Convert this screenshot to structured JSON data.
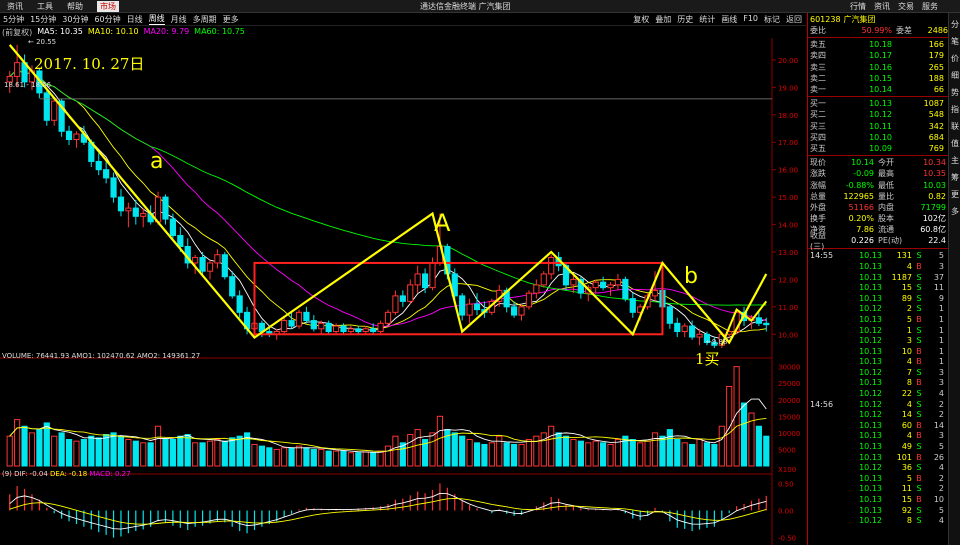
{
  "menu": {
    "items": [
      "资讯",
      "工具",
      "帮助",
      "市场"
    ],
    "active": "市场",
    "window_title": "通达信金融终端 广汽集团",
    "right_items": [
      "行情",
      "资讯",
      "交易",
      "服务"
    ]
  },
  "toolbar": {
    "periods": [
      "5分钟",
      "15分钟",
      "30分钟",
      "60分钟",
      "日线",
      "周线",
      "月线",
      "多周期",
      "更多"
    ],
    "selected": "周线",
    "right_tools": [
      "复权",
      "叠加",
      "历史",
      "统计",
      "画线",
      "F10",
      "标记",
      "返回"
    ]
  },
  "legend": {
    "label": "(前复权)",
    "ma5": "MA5: 10.35",
    "ma10": "MA10: 10.10",
    "ma20": "MA20: 9.79",
    "ma60": "MA60: 10.75"
  },
  "annotations": {
    "date": "2017. 10. 27日",
    "a": "a",
    "A": "A",
    "b": "b",
    "buy": "1买",
    "high_price": "20.55",
    "low_price": "9.88",
    "h_line": "18.61 - 18.56"
  },
  "sub_legends": {
    "vol": "VOLUME: 76441.93  AMO1: 102470.62  AMO2: 149361.27",
    "macd_dif": "(9) DIF: -0.04",
    "macd_dea": "DEA: -0.18",
    "macd_macd": "MACD: 0.27"
  },
  "colors": {
    "up": "#ff3333",
    "down": "#00e5ee",
    "ma5": "#ffffff",
    "ma10": "#ffff00",
    "ma20": "#ff00ff",
    "ma60": "#00ff00",
    "yellow_drawing": "#ffff00",
    "box": "#ff2020"
  },
  "chart_data": {
    "type": "candlestick",
    "y_ticks": [
      "20.00",
      "19.00",
      "18.00",
      "17.00",
      "16.00",
      "15.00",
      "14.00",
      "13.00",
      "12.00",
      "11.00",
      "10.00"
    ],
    "vol_ticks": [
      "30000",
      "25000",
      "20000",
      "15000",
      "10000",
      "5000"
    ],
    "vol_unit": "X100",
    "macd_ticks": [
      "0.50",
      "0.00",
      "-0.50"
    ],
    "ylim": [
      9.5,
      20.8
    ],
    "candles": [
      [
        19.2,
        19.6,
        18.8,
        19.4
      ],
      [
        19.4,
        20.55,
        19.0,
        19.9
      ],
      [
        19.9,
        20.2,
        19.0,
        19.2
      ],
      [
        19.2,
        19.8,
        18.9,
        19.6
      ],
      [
        19.6,
        19.7,
        18.6,
        18.8
      ],
      [
        18.8,
        19.0,
        17.6,
        17.8
      ],
      [
        17.8,
        18.6,
        17.6,
        18.5
      ],
      [
        18.5,
        18.6,
        17.2,
        17.4
      ],
      [
        17.4,
        17.6,
        16.9,
        17.1
      ],
      [
        17.1,
        17.4,
        16.8,
        17.3
      ],
      [
        17.3,
        17.6,
        16.9,
        17.0
      ],
      [
        17.0,
        17.1,
        16.1,
        16.3
      ],
      [
        16.3,
        16.6,
        15.8,
        16.0
      ],
      [
        16.0,
        16.4,
        15.5,
        15.7
      ],
      [
        15.7,
        15.9,
        14.8,
        15.0
      ],
      [
        15.0,
        15.3,
        14.3,
        14.5
      ],
      [
        14.5,
        14.8,
        13.9,
        14.6
      ],
      [
        14.6,
        14.9,
        14.0,
        14.3
      ],
      [
        14.3,
        14.6,
        13.9,
        14.4
      ],
      [
        14.4,
        14.7,
        14.0,
        14.1
      ],
      [
        14.1,
        15.2,
        14.0,
        15.0
      ],
      [
        15.0,
        15.1,
        14.0,
        14.2
      ],
      [
        14.2,
        14.4,
        13.5,
        13.6
      ],
      [
        13.6,
        13.9,
        13.0,
        13.2
      ],
      [
        13.2,
        13.5,
        12.4,
        12.6
      ],
      [
        12.6,
        12.9,
        12.2,
        12.8
      ],
      [
        12.8,
        13.0,
        12.2,
        12.3
      ],
      [
        12.3,
        12.7,
        12.0,
        12.6
      ],
      [
        12.6,
        13.1,
        12.4,
        12.9
      ],
      [
        12.9,
        13.0,
        12.0,
        12.1
      ],
      [
        12.1,
        12.3,
        11.3,
        11.4
      ],
      [
        11.4,
        11.6,
        10.6,
        10.8
      ],
      [
        10.8,
        11.0,
        10.0,
        10.2
      ],
      [
        10.2,
        10.6,
        9.9,
        10.4
      ],
      [
        10.4,
        10.5,
        9.9,
        10.1
      ],
      [
        10.1,
        10.3,
        9.9,
        10.0
      ],
      [
        10.0,
        10.2,
        9.8,
        10.1
      ],
      [
        10.1,
        10.6,
        10.0,
        10.5
      ],
      [
        10.5,
        10.8,
        10.2,
        10.3
      ],
      [
        10.3,
        10.9,
        10.2,
        10.8
      ],
      [
        10.8,
        11.0,
        10.4,
        10.5
      ],
      [
        10.5,
        10.7,
        10.1,
        10.2
      ],
      [
        10.2,
        10.5,
        10.0,
        10.4
      ],
      [
        10.4,
        10.5,
        10.0,
        10.1
      ],
      [
        10.1,
        10.4,
        10.0,
        10.3
      ],
      [
        10.3,
        10.4,
        10.0,
        10.1
      ],
      [
        10.1,
        10.3,
        10.0,
        10.2
      ],
      [
        10.2,
        10.3,
        10.0,
        10.1
      ],
      [
        10.1,
        10.3,
        10.0,
        10.2
      ],
      [
        10.2,
        10.4,
        10.0,
        10.1
      ],
      [
        10.1,
        10.5,
        10.0,
        10.4
      ],
      [
        10.4,
        10.9,
        10.3,
        10.8
      ],
      [
        10.8,
        11.6,
        10.7,
        11.4
      ],
      [
        11.4,
        11.6,
        11.0,
        11.2
      ],
      [
        11.2,
        12.0,
        11.1,
        11.8
      ],
      [
        11.8,
        12.5,
        11.5,
        12.2
      ],
      [
        12.2,
        12.4,
        11.5,
        11.7
      ],
      [
        11.7,
        12.8,
        11.6,
        12.6
      ],
      [
        12.6,
        14.4,
        12.5,
        13.2
      ],
      [
        13.2,
        13.3,
        12.0,
        12.2
      ],
      [
        12.2,
        12.4,
        11.2,
        11.4
      ],
      [
        11.4,
        11.5,
        10.5,
        10.7
      ],
      [
        10.7,
        11.3,
        10.4,
        11.1
      ],
      [
        11.1,
        11.5,
        10.7,
        10.9
      ],
      [
        10.9,
        11.2,
        10.6,
        10.8
      ],
      [
        10.8,
        11.3,
        10.7,
        11.2
      ],
      [
        11.2,
        11.8,
        11.0,
        11.6
      ],
      [
        11.6,
        11.7,
        10.8,
        11.0
      ],
      [
        11.0,
        11.2,
        10.6,
        10.7
      ],
      [
        10.7,
        11.1,
        10.5,
        11.0
      ],
      [
        11.0,
        11.6,
        10.9,
        11.5
      ],
      [
        11.5,
        12.0,
        11.3,
        11.8
      ],
      [
        11.8,
        12.3,
        11.7,
        12.2
      ],
      [
        12.2,
        12.9,
        12.0,
        12.8
      ],
      [
        12.8,
        13.0,
        12.3,
        12.5
      ],
      [
        12.5,
        12.6,
        11.6,
        11.8
      ],
      [
        11.8,
        12.2,
        11.5,
        12.0
      ],
      [
        12.0,
        12.1,
        11.3,
        11.5
      ],
      [
        11.5,
        11.8,
        11.2,
        11.7
      ],
      [
        11.7,
        12.0,
        11.5,
        11.9
      ],
      [
        11.9,
        12.1,
        11.6,
        11.7
      ],
      [
        11.7,
        11.9,
        11.4,
        11.8
      ],
      [
        11.8,
        12.2,
        11.6,
        12.0
      ],
      [
        12.0,
        12.1,
        11.2,
        11.3
      ],
      [
        11.3,
        11.5,
        10.6,
        10.8
      ],
      [
        10.8,
        11.1,
        10.5,
        11.0
      ],
      [
        11.0,
        11.5,
        10.9,
        11.4
      ],
      [
        11.4,
        12.3,
        11.2,
        11.6
      ],
      [
        11.6,
        11.8,
        10.9,
        11.0
      ],
      [
        11.0,
        11.1,
        10.2,
        10.4
      ],
      [
        10.4,
        10.6,
        9.9,
        10.1
      ],
      [
        10.1,
        10.4,
        9.9,
        10.3
      ],
      [
        10.3,
        10.5,
        9.8,
        9.9
      ],
      [
        9.9,
        10.2,
        9.6,
        10.0
      ],
      [
        10.0,
        10.1,
        9.6,
        9.7
      ],
      [
        9.7,
        9.9,
        9.5,
        9.6
      ],
      [
        9.6,
        10.1,
        9.5,
        10.0
      ],
      [
        10.0,
        10.2,
        9.88,
        10.1
      ],
      [
        10.1,
        10.9,
        10.0,
        10.8
      ],
      [
        10.8,
        11.0,
        10.3,
        10.5
      ],
      [
        10.5,
        10.7,
        10.2,
        10.6
      ],
      [
        10.6,
        10.8,
        10.3,
        10.4
      ],
      [
        10.4,
        10.6,
        10.1,
        10.35
      ]
    ],
    "volumes": [
      9000,
      14000,
      12000,
      10000,
      11000,
      13000,
      9000,
      10000,
      8000,
      7500,
      8000,
      9000,
      8500,
      9500,
      10000,
      9000,
      8000,
      7500,
      7000,
      7000,
      12000,
      8000,
      8000,
      9000,
      9500,
      7000,
      7000,
      7500,
      8000,
      7500,
      8500,
      9000,
      10000,
      6500,
      6000,
      5500,
      5000,
      5500,
      5500,
      6000,
      5500,
      5000,
      5000,
      4500,
      4500,
      4500,
      4000,
      4000,
      4200,
      4000,
      4500,
      6000,
      9000,
      7000,
      9500,
      11000,
      8000,
      10000,
      15000,
      11000,
      10000,
      9000,
      8000,
      7000,
      6500,
      7000,
      9000,
      7000,
      6500,
      6500,
      8000,
      9000,
      10000,
      12000,
      10000,
      9000,
      8000,
      7500,
      7000,
      7500,
      7000,
      6500,
      8000,
      9000,
      8000,
      7000,
      7500,
      10000,
      9000,
      11000,
      8000,
      7000,
      6500,
      8000,
      7000,
      6500,
      12000,
      24000,
      30000,
      19000,
      16000,
      12000,
      9000
    ],
    "macd": [
      0.3,
      0.45,
      0.4,
      0.3,
      0.2,
      0.05,
      -0.05,
      -0.15,
      -0.2,
      -0.25,
      -0.3,
      -0.35,
      -0.4,
      -0.45,
      -0.5,
      -0.48,
      -0.42,
      -0.38,
      -0.35,
      -0.3,
      -0.2,
      -0.22,
      -0.28,
      -0.32,
      -0.36,
      -0.3,
      -0.28,
      -0.24,
      -0.2,
      -0.22,
      -0.3,
      -0.38,
      -0.42,
      -0.36,
      -0.3,
      -0.25,
      -0.2,
      -0.12,
      -0.06,
      0.02,
      0.05,
      0.04,
      0.03,
      0.02,
      0.03,
      0.02,
      0.03,
      0.04,
      0.05,
      0.06,
      0.08,
      0.12,
      0.2,
      0.22,
      0.28,
      0.35,
      0.32,
      0.38,
      0.5,
      0.42,
      0.3,
      0.18,
      0.1,
      0.04,
      0.0,
      -0.05,
      0.02,
      -0.06,
      -0.1,
      -0.08,
      0.02,
      0.08,
      0.15,
      0.25,
      0.22,
      0.12,
      0.1,
      0.04,
      0.02,
      0.03,
      0.02,
      0.01,
      0.04,
      -0.05,
      -0.15,
      -0.18,
      -0.1,
      0.05,
      -0.04,
      -0.2,
      -0.32,
      -0.34,
      -0.38,
      -0.35,
      -0.32,
      -0.3,
      -0.18,
      -0.05,
      0.08,
      0.12,
      0.18,
      0.22,
      0.27
    ]
  },
  "drawing": {
    "zigzag": [
      [
        0,
        20.55
      ],
      [
        33,
        9.88
      ],
      [
        57,
        14.4
      ],
      [
        61,
        10.1
      ],
      [
        73,
        13.0
      ],
      [
        84,
        10.0
      ],
      [
        88,
        12.6
      ],
      [
        97,
        9.7
      ],
      [
        102,
        12.2
      ]
    ],
    "zigzag2": [
      [
        96,
        9.6
      ],
      [
        98,
        10.9
      ],
      [
        100,
        10.5
      ],
      [
        102,
        11.2
      ]
    ],
    "box": {
      "x0": 33,
      "x1": 88,
      "y0": 10.0,
      "y1": 12.6
    }
  },
  "quote": {
    "code": "601238",
    "name": "广汽集团",
    "webi_label": "委比",
    "webi": "50.99%",
    "weicha_label": "委差",
    "weicha": "2486",
    "asks": [
      {
        "label": "卖五",
        "price": "10.18",
        "vol": "166"
      },
      {
        "label": "卖四",
        "price": "10.17",
        "vol": "179"
      },
      {
        "label": "卖三",
        "price": "10.16",
        "vol": "265"
      },
      {
        "label": "卖二",
        "price": "10.15",
        "vol": "188"
      },
      {
        "label": "卖一",
        "price": "10.14",
        "vol": "66"
      }
    ],
    "bids": [
      {
        "label": "买一",
        "price": "10.13",
        "vol": "1087"
      },
      {
        "label": "买二",
        "price": "10.12",
        "vol": "548"
      },
      {
        "label": "买三",
        "price": "10.11",
        "vol": "342"
      },
      {
        "label": "买四",
        "price": "10.10",
        "vol": "684"
      },
      {
        "label": "买五",
        "price": "10.09",
        "vol": "769"
      }
    ],
    "stats": [
      {
        "a": "现价",
        "av": "10.14",
        "ac": "green",
        "b": "今开",
        "bv": "10.34",
        "bc": "red"
      },
      {
        "a": "涨跌",
        "av": "-0.09",
        "ac": "green",
        "b": "最高",
        "bv": "10.35",
        "bc": "red"
      },
      {
        "a": "涨幅",
        "av": "-0.88%",
        "ac": "green",
        "b": "最低",
        "bv": "10.03",
        "bc": "green"
      },
      {
        "a": "总量",
        "av": "122965",
        "ac": "yellow",
        "b": "量比",
        "bv": "0.82",
        "bc": "yellow"
      },
      {
        "a": "外盘",
        "av": "51166",
        "ac": "red",
        "b": "内盘",
        "bv": "71799",
        "bc": "green"
      },
      {
        "a": "换手",
        "av": "0.20%",
        "ac": "yellow",
        "b": "股本",
        "bv": "102亿",
        "bc": "white"
      },
      {
        "a": "净资",
        "av": "7.86",
        "ac": "yellow",
        "b": "流通",
        "bv": "60.8亿",
        "bc": "white"
      },
      {
        "a": "收益(三)",
        "av": "0.226",
        "ac": "white",
        "b": "PE(动)",
        "bv": "22.4",
        "bc": "white"
      }
    ],
    "ticks": [
      {
        "t": "14:55",
        "p": "10.13",
        "v": "131",
        "d": "S",
        "n": "5"
      },
      {
        "t": "",
        "p": "10.13",
        "v": "4",
        "d": "B",
        "n": "3"
      },
      {
        "t": "",
        "p": "10.13",
        "v": "1187",
        "d": "S",
        "n": "37"
      },
      {
        "t": "",
        "p": "10.13",
        "v": "15",
        "d": "S",
        "n": "11"
      },
      {
        "t": "",
        "p": "10.13",
        "v": "89",
        "d": "S",
        "n": "9"
      },
      {
        "t": "",
        "p": "10.12",
        "v": "2",
        "d": "S",
        "n": "1"
      },
      {
        "t": "",
        "p": "10.13",
        "v": "5",
        "d": "B",
        "n": "1"
      },
      {
        "t": "",
        "p": "10.12",
        "v": "1",
        "d": "S",
        "n": "1"
      },
      {
        "t": "",
        "p": "10.12",
        "v": "3",
        "d": "S",
        "n": "1"
      },
      {
        "t": "",
        "p": "10.13",
        "v": "10",
        "d": "B",
        "n": "1"
      },
      {
        "t": "",
        "p": "10.13",
        "v": "4",
        "d": "B",
        "n": "1"
      },
      {
        "t": "",
        "p": "10.12",
        "v": "7",
        "d": "S",
        "n": "3"
      },
      {
        "t": "",
        "p": "10.13",
        "v": "8",
        "d": "B",
        "n": "3"
      },
      {
        "t": "",
        "p": "10.12",
        "v": "22",
        "d": "S",
        "n": "4"
      },
      {
        "t": "14:56",
        "p": "10.12",
        "v": "4",
        "d": "S",
        "n": "2"
      },
      {
        "t": "",
        "p": "10.12",
        "v": "14",
        "d": "S",
        "n": "2"
      },
      {
        "t": "",
        "p": "10.13",
        "v": "60",
        "d": "B",
        "n": "14"
      },
      {
        "t": "",
        "p": "10.13",
        "v": "4",
        "d": "B",
        "n": "3"
      },
      {
        "t": "",
        "p": "10.13",
        "v": "49",
        "d": "S",
        "n": "5"
      },
      {
        "t": "",
        "p": "10.13",
        "v": "101",
        "d": "B",
        "n": "26"
      },
      {
        "t": "",
        "p": "10.12",
        "v": "36",
        "d": "S",
        "n": "4"
      },
      {
        "t": "",
        "p": "10.13",
        "v": "5",
        "d": "B",
        "n": "2"
      },
      {
        "t": "",
        "p": "10.13",
        "v": "11",
        "d": "S",
        "n": "2"
      },
      {
        "t": "",
        "p": "10.13",
        "v": "15",
        "d": "B",
        "n": "10"
      },
      {
        "t": "",
        "p": "10.13",
        "v": "92",
        "d": "S",
        "n": "5"
      },
      {
        "t": "",
        "p": "10.12",
        "v": "8",
        "d": "S",
        "n": "4"
      }
    ]
  },
  "side_tabs": [
    "分",
    "笔",
    "价",
    "细",
    "势",
    "指",
    "联",
    "值",
    "主",
    "筹",
    "更",
    "多"
  ]
}
